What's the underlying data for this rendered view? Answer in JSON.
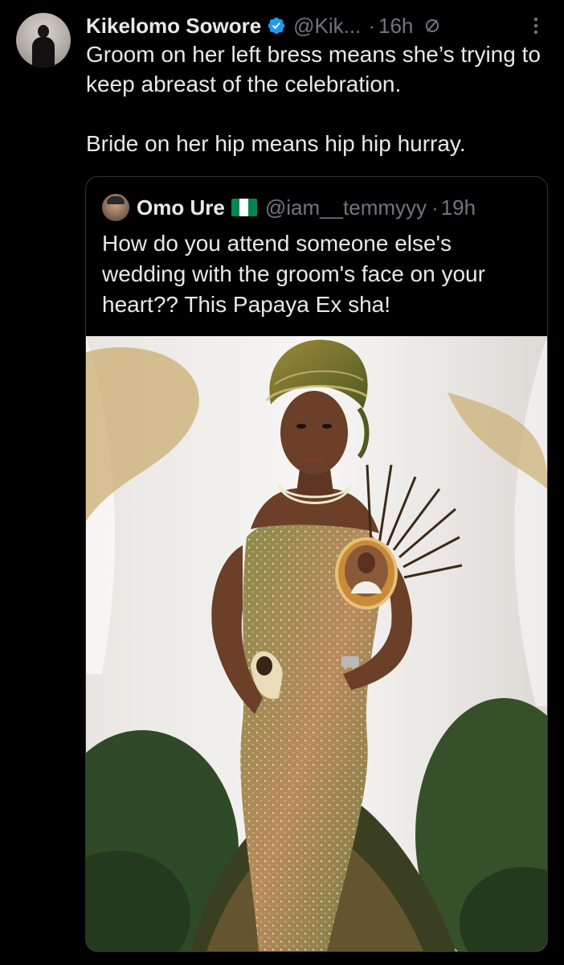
{
  "tweet": {
    "author_name": "Kikelomo Sowore",
    "author_handle": "@Kik...",
    "separator": "·",
    "time": "16h",
    "text_line_1": "Groom on her left bress means she’s trying to keep abreast of the celebration.",
    "text_line_2": "Bride  on her hip means hip hip hurray."
  },
  "quoted_tweet": {
    "author_name": "Omo Ure",
    "author_handle": "@iam__temmyyy",
    "separator": "·",
    "time": "19h",
    "text": "How do you attend someone else's wedding with the groom's face on your heart?? This Papaya Ex sha!"
  },
  "icons": {
    "verified": "verified-badge-icon",
    "edited": "edited-icon",
    "more": "more-options-icon",
    "flag": "nigeria-flag-icon"
  },
  "colors": {
    "background": "#000000",
    "primary_text": "#e7e9ea",
    "secondary_text": "#71767b",
    "verified_blue": "#1d9bf0",
    "border": "#2f3336",
    "flag_green": "#008751"
  }
}
